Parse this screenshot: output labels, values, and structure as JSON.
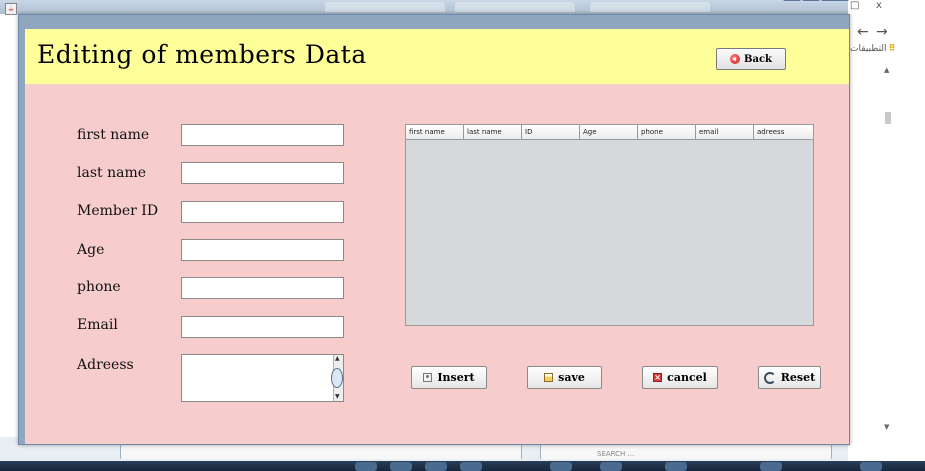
{
  "window": {
    "close_glyph": "x",
    "minimize_glyph": "_",
    "maximize_glyph": "□",
    "java_icon": "java-cup-icon"
  },
  "browser": {
    "back_arrow": "←",
    "forward_arrow": "→",
    "apps_label": "التطبيقات",
    "apps_icon": "⠿",
    "scroll_up": "▲",
    "scroll_down": "▼",
    "top_close": "x",
    "top_restore": "□",
    "search_placeholder": "SEARCH ..."
  },
  "header": {
    "title": "Editing of members Data",
    "back_label": "Back",
    "background": "#ffff99"
  },
  "form": {
    "background": "#f6cccc",
    "fields": [
      {
        "label": "first name",
        "value": ""
      },
      {
        "label": "last name",
        "value": ""
      },
      {
        "label": "Member ID",
        "value": ""
      },
      {
        "label": "Age",
        "value": ""
      },
      {
        "label": "phone",
        "value": ""
      },
      {
        "label": "Email",
        "value": ""
      }
    ],
    "address": {
      "label": "Adreess",
      "value": ""
    }
  },
  "table": {
    "columns": [
      "first name",
      "last name",
      "ID",
      "Age",
      "phone",
      "email",
      "adreess"
    ],
    "rows": []
  },
  "actions": {
    "insert": "Insert",
    "save": "save",
    "cancel": "cancel",
    "reset": "Reset"
  }
}
